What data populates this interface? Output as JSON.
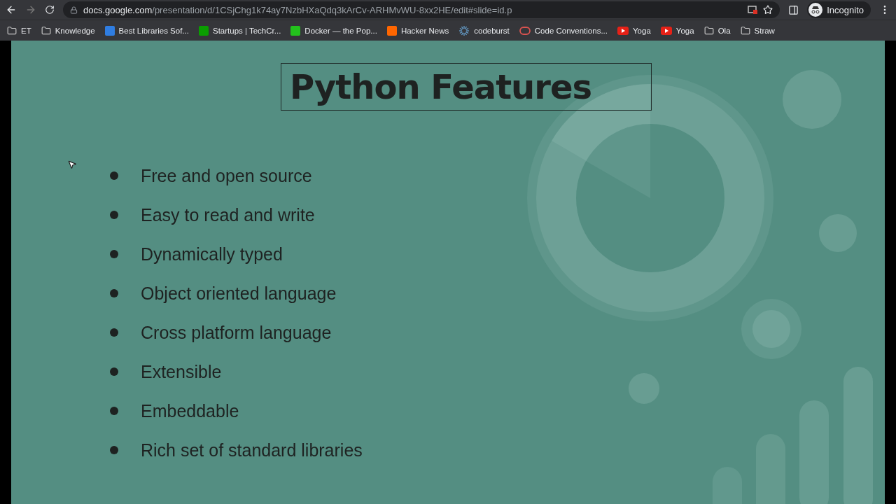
{
  "browser": {
    "url_host": "docs.google.com",
    "url_path": "/presentation/d/1CSjChg1k74ay7NzbHXaQdq3kArCv-ARHMvWU-8xx2HE/edit#slide=id.p",
    "profile": "Incognito"
  },
  "bookmarks": [
    {
      "label": "ET",
      "kind": "folder"
    },
    {
      "label": "Knowledge",
      "kind": "folder"
    },
    {
      "label": "Best Libraries Sof...",
      "kind": "site",
      "color": "#2f7de1"
    },
    {
      "label": "Startups | TechCr...",
      "kind": "site",
      "color": "#0a9e01"
    },
    {
      "label": "Docker — the Pop...",
      "kind": "site",
      "color": "#23c21c"
    },
    {
      "label": "Hacker News",
      "kind": "site",
      "color": "#ff6600"
    },
    {
      "label": "codeburst",
      "kind": "spark"
    },
    {
      "label": "Code Conventions...",
      "kind": "ring",
      "color": "#d9534f"
    },
    {
      "label": "Yoga",
      "kind": "play",
      "color": "#e62117"
    },
    {
      "label": "Yoga",
      "kind": "play",
      "color": "#e62117"
    },
    {
      "label": "Ola",
      "kind": "folder"
    },
    {
      "label": "Straw",
      "kind": "folder"
    }
  ],
  "slide": {
    "title": "Python Features",
    "bullets": [
      "Free and open source",
      "Easy to read and write",
      "Dynamically typed",
      "Object oriented language",
      "Cross platform language",
      "Extensible",
      "Embeddable",
      "Rich set of standard libraries"
    ]
  }
}
